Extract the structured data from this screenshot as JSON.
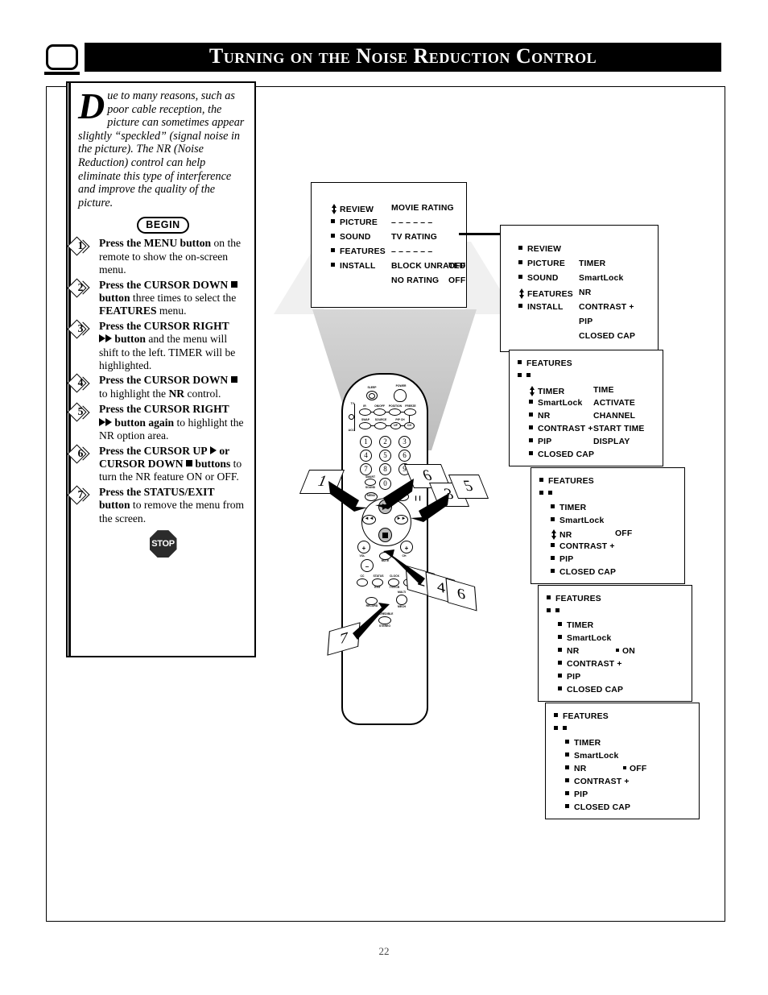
{
  "header": {
    "title": "Turning on the Noise Reduction Control",
    "tv_icon": "tv-screen-icon"
  },
  "instructions": {
    "intro_dropcap": "D",
    "intro_text": "ue to many reasons, such as poor cable reception, the picture can sometimes appear slightly “speckled” (signal noise in the picture). The NR (Noise Reduction) control can help eliminate this type of interference and improve the quality of the picture.",
    "begin_label": "BEGIN",
    "stop_label": "STOP",
    "steps": [
      {
        "num": "1",
        "bold_lead": "Press the MENU button",
        "rest": " on the remote to show the on-screen menu."
      },
      {
        "num": "2",
        "bold_lead": "Press the CURSOR DOWN",
        "icon": "square",
        "bold_after": "button",
        "rest": " three times to select the ",
        "bold_tail": "FEATURES",
        "rest2": " menu."
      },
      {
        "num": "3",
        "bold_lead": "Press the CURSOR RIGHT",
        "icon": "double-right-triangle",
        "bold_after": "button",
        "rest": " and the menu will shift to the left. TIMER will be highlighted."
      },
      {
        "num": "4",
        "bold_lead": "Press the CURSOR DOWN",
        "icon": "square",
        "rest": " to highlight the ",
        "bold_tail": "NR",
        "rest2": " control."
      },
      {
        "num": "5",
        "bold_lead": "Press the CURSOR RIGHT",
        "icon": "double-right-triangle",
        "bold_after": "button again",
        "rest": " to highlight the NR option area."
      },
      {
        "num": "6",
        "bold_lead": "Press the CURSOR UP",
        "icon": "right-triangle",
        "bold_mid": "or CURSOR DOWN",
        "icon2": "square",
        "bold_after": "buttons",
        "rest": " to turn the NR feature ON or OFF."
      },
      {
        "num": "7",
        "bold_lead": "Press the STATUS/EXIT button",
        "rest": " to remove the menu from the screen."
      }
    ]
  },
  "osd_menus": [
    {
      "name": "main-menu-ratings",
      "left_items": [
        {
          "label": "REVIEW",
          "cursor": true
        },
        {
          "label": "PICTURE"
        },
        {
          "label": "SOUND"
        },
        {
          "label": "FEATURES"
        },
        {
          "label": "INSTALL"
        }
      ],
      "right_items": [
        {
          "label": "MOVIE RATING"
        },
        {
          "label": "– – – – – –"
        },
        {
          "label": "TV RATING"
        },
        {
          "label": "– – – – – –"
        },
        {
          "label": "BLOCK UNRATED",
          "value": "OFF"
        },
        {
          "label": "NO RATING",
          "value": "OFF"
        }
      ]
    },
    {
      "name": "features-selected-menu",
      "left_items": [
        {
          "label": "REVIEW"
        },
        {
          "label": "PICTURE"
        },
        {
          "label": "SOUND"
        },
        {
          "label": "FEATURES",
          "cursor": true
        },
        {
          "label": "INSTALL"
        }
      ],
      "right_items": [
        {
          "label": ""
        },
        {
          "label": "TIMER"
        },
        {
          "label": "SmartLock"
        },
        {
          "label": "NR"
        },
        {
          "label": "CONTRAST +"
        },
        {
          "label": "PIP"
        },
        {
          "label": "CLOSED CAP"
        }
      ]
    },
    {
      "name": "features-timer-menu",
      "header": "FEATURES",
      "left_items": [
        {
          "label": "TIMER",
          "cursor": true
        },
        {
          "label": "SmartLock"
        },
        {
          "label": "NR"
        },
        {
          "label": "CONTRAST +"
        },
        {
          "label": "PIP"
        },
        {
          "label": "CLOSED CAP"
        }
      ],
      "right_items": [
        {
          "label": "TIME"
        },
        {
          "label": "ACTIVATE"
        },
        {
          "label": "CHANNEL"
        },
        {
          "label": "START TIME"
        },
        {
          "label": "DISPLAY"
        }
      ]
    },
    {
      "name": "features-nr-highlighted-menu",
      "header": "FEATURES",
      "left_items": [
        {
          "label": "TIMER"
        },
        {
          "label": "SmartLock"
        },
        {
          "label": "NR",
          "cursor": true,
          "value": "OFF"
        },
        {
          "label": "CONTRAST +"
        },
        {
          "label": "PIP"
        },
        {
          "label": "CLOSED CAP"
        }
      ]
    },
    {
      "name": "features-nr-on-menu",
      "header": "FEATURES",
      "left_items": [
        {
          "label": "TIMER"
        },
        {
          "label": "SmartLock"
        },
        {
          "label": "NR",
          "value": "ON",
          "value_bullet": true
        },
        {
          "label": "CONTRAST +"
        },
        {
          "label": "PIP"
        },
        {
          "label": "CLOSED CAP"
        }
      ]
    },
    {
      "name": "features-nr-off-menu",
      "header": "FEATURES",
      "left_items": [
        {
          "label": "TIMER"
        },
        {
          "label": "SmartLock"
        },
        {
          "label": "NR",
          "value": "OFF",
          "value_bullet": true
        },
        {
          "label": "CONTRAST +"
        },
        {
          "label": "PIP"
        },
        {
          "label": "CLOSED CAP"
        }
      ]
    }
  ],
  "remote": {
    "name": "tv-remote-control",
    "labels": [
      "SLEEP",
      "POWER",
      "IR",
      "ON/OFF",
      "POSITION",
      "FREEZE",
      "SWAP",
      "SOURCE",
      "PIP CH",
      "UP",
      "CH",
      "TV",
      "VCR",
      "ACC",
      "SMART",
      "SOUND",
      "MENU",
      "SURF",
      "VOL",
      "MUTE",
      "CC",
      "STATUS",
      "EXIT",
      "CLOCK",
      "TV/VCR",
      "RECORD",
      "MULTI",
      "MECH",
      "INCREDIBLE",
      "STEREO"
    ],
    "keypad": [
      "1",
      "2",
      "3",
      "4",
      "5",
      "6",
      "7",
      "8",
      "9",
      "0"
    ]
  },
  "callouts": [
    {
      "label": "1",
      "target": "menu-button"
    },
    {
      "label": "6",
      "target": "surf-button"
    },
    {
      "label": "3",
      "target": "cursor-right-button"
    },
    {
      "label": "5",
      "target": "cursor-right-button"
    },
    {
      "label": "2",
      "target": "cursor-down-button"
    },
    {
      "label": "4",
      "target": "cursor-down-button"
    },
    {
      "label": "6",
      "target": "cursor-down-button"
    },
    {
      "label": "7",
      "target": "status-exit-button"
    }
  ],
  "page": {
    "number": "22"
  }
}
